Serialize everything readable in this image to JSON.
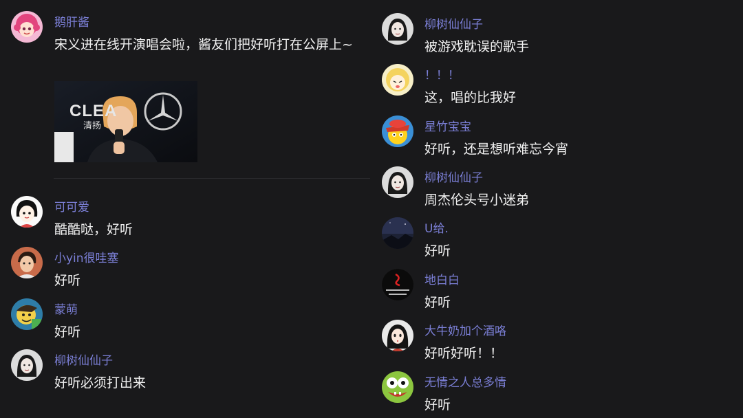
{
  "left_comments": [
    {
      "username": "鹅肝酱",
      "text": "宋义进在线开演唱会啦，酱友们把好听打在公屏上~",
      "avatar_icon": "pink-hair-avatar-icon"
    },
    {
      "username": "可可爱",
      "text": "酷酷哒，好听",
      "avatar_icon": "cartoon-girl-avatar-icon"
    },
    {
      "username": "小yin很哇塞",
      "text": "好听",
      "avatar_icon": "boy-avatar-icon"
    },
    {
      "username": "蒙萌",
      "text": "好听",
      "avatar_icon": "cartoon-avatar-icon"
    },
    {
      "username": "柳树仙仙子",
      "text": "好听必须打出来",
      "avatar_icon": "girl-bw-avatar-icon"
    }
  ],
  "right_comments": [
    {
      "username": "柳树仙仙子",
      "text": "被游戏耽误的歌手",
      "avatar_icon": "girl-bw-avatar-icon"
    },
    {
      "username": "！！！",
      "text": "这，唱的比我好",
      "avatar_icon": "blonde-cartoon-avatar-icon"
    },
    {
      "username": "星竹宝宝",
      "text": "好听，还是想听难忘今宵",
      "avatar_icon": "yellow-character-avatar-icon"
    },
    {
      "username": "柳树仙仙子",
      "text": "周杰伦头号小迷弟",
      "avatar_icon": "girl-bw-avatar-icon"
    },
    {
      "username": "U给.",
      "text": "好听",
      "avatar_icon": "night-sky-avatar-icon"
    },
    {
      "username": "地白白",
      "text": "好听",
      "avatar_icon": "dark-text-avatar-icon"
    },
    {
      "username": "大牛奶加个酒咯",
      "text": "好听好听！！",
      "avatar_icon": "anime-girl-avatar-icon"
    },
    {
      "username": "无情之人总多情",
      "text": "好听",
      "avatar_icon": "frog-avatar-icon"
    }
  ],
  "thumbnail": {
    "logo_text": "CLEA",
    "logo_sub": "清扬",
    "icon": "video-thumbnail-icon"
  },
  "colors": {
    "background": "#19191b",
    "username": "#7b7fd6",
    "text": "#f1f1f1"
  }
}
